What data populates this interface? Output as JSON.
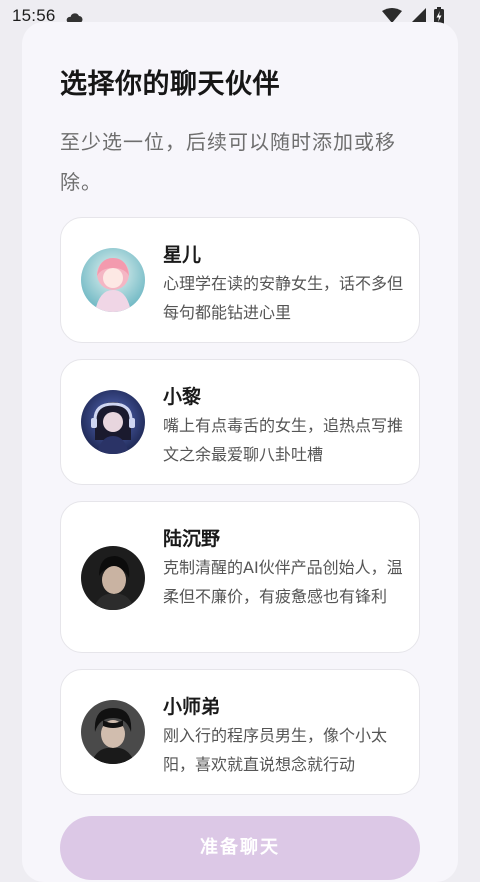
{
  "status_bar": {
    "time": "15:56",
    "cloud_icon": "cloud-icon",
    "wifi_icon": "wifi-icon",
    "signal_icon": "signal-icon",
    "battery_icon": "battery-charging-icon"
  },
  "header": {
    "title": "选择你的聊天伙伴",
    "subtitle": "至少选一位，后续可以随时添加或移除。"
  },
  "companions": [
    {
      "name": "星儿",
      "description": "心理学在读的安静女生，话不多但每句都能钻进心里",
      "avatar_colors": [
        "#8ecfd8",
        "#f4b6c4"
      ]
    },
    {
      "name": "小黎",
      "description": "嘴上有点毒舌的女生，追热点写推文之余最爱聊八卦吐槽",
      "avatar_colors": [
        "#1e2a5a",
        "#8fa0d8"
      ]
    },
    {
      "name": "陆沉野",
      "description": "克制清醒的AI伙伴产品创始人，温柔但不廉价，有疲惫感也有锋利",
      "avatar_colors": [
        "#1a1a1a",
        "#b8a89a"
      ]
    },
    {
      "name": "小师弟",
      "description": "刚入行的程序员男生，像个小太阳，喜欢就直说想念就行动",
      "avatar_colors": [
        "#1c1c1c",
        "#c4b2a4"
      ]
    }
  ],
  "actions": {
    "start_label": "准备聊天"
  },
  "colors": {
    "background": "#eeedf2",
    "sheet": "#f7f6fb",
    "button_disabled": "#dcc8e6"
  }
}
